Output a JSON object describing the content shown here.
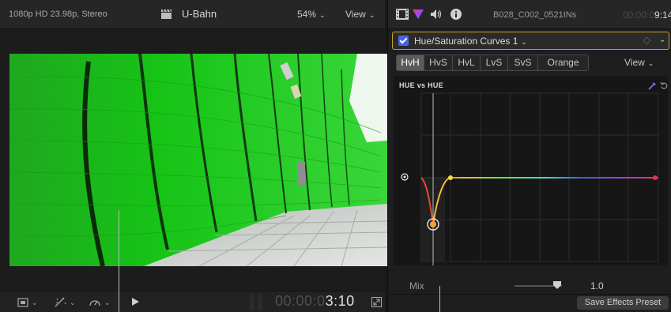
{
  "viewer": {
    "format": "1080p HD 23.98p, Stereo",
    "clip_title": "U-Bahn",
    "zoom": "54%",
    "view_menu": "View",
    "timecode_dim": "00:00:0",
    "timecode_bright": "3:10"
  },
  "inspector": {
    "clip_name": "B028_C002_0521INs",
    "timecode_dim": "00:00:0",
    "timecode_bright": "9:14",
    "effect_name": "Hue/Saturation Curves 1",
    "curve_tabs": [
      "HvH",
      "HvS",
      "HvL",
      "LvS",
      "SvS",
      "Orange"
    ],
    "active_tab": "HvH",
    "curve_view_menu": "View",
    "curve_title": "HUE vs HUE",
    "mix_label": "Mix",
    "mix_value": "1.0",
    "mix_level": 1.0,
    "save_preset_label": "Save Effects Preset"
  },
  "colors": {
    "accent_yellow": "#c9a227",
    "checkbox_blue": "#4a63e0",
    "tunnel_green": "#16c416",
    "control_point_orange": "#f2a23a",
    "control_point_yellow": "#f2e23a",
    "end_point_red": "#e6324b"
  },
  "icons": [
    "clapper-icon",
    "chevron-down-icon",
    "film-icon",
    "color-icon",
    "audio-icon",
    "info-icon",
    "eyedropper-icon",
    "reset-icon",
    "target-icon",
    "play-icon",
    "crop-icon",
    "enhance-icon",
    "speed-icon",
    "fullscreen-icon"
  ]
}
